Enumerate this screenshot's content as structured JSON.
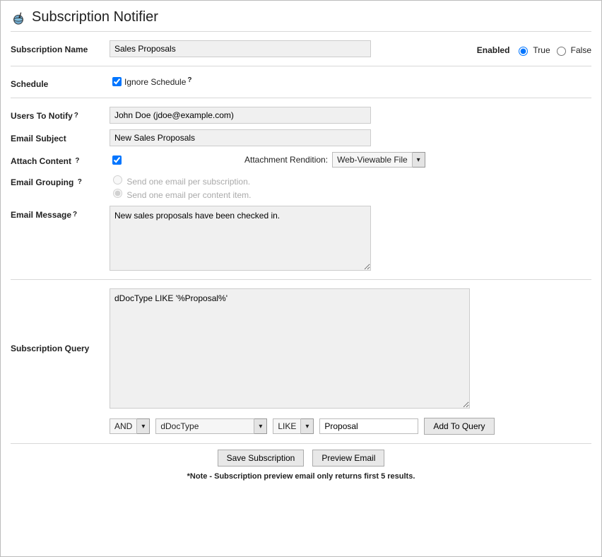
{
  "header": {
    "title": "Subscription Notifier"
  },
  "enabled": {
    "label": "Enabled",
    "true_label": "True",
    "false_label": "False",
    "value": "true"
  },
  "fields": {
    "name_label": "Subscription Name",
    "name_value": "Sales Proposals",
    "schedule_label": "Schedule",
    "ignore_schedule_label": "Ignore Schedule",
    "ignore_schedule_checked": true,
    "users_label": "Users To Notify",
    "users_value": "John Doe (jdoe@example.com)",
    "subject_label": "Email Subject",
    "subject_value": "New Sales Proposals",
    "attach_label": "Attach Content",
    "attach_checked": true,
    "rendition_label": "Attachment Rendition:",
    "rendition_value": "Web-Viewable File",
    "grouping_label": "Email Grouping",
    "grouping_opt1": "Send one email per subscription.",
    "grouping_opt2": "Send one email per content item.",
    "message_label": "Email Message",
    "message_value": "New sales proposals have been checked in.",
    "query_label": "Subscription Query",
    "query_value": "dDocType LIKE '%Proposal%'"
  },
  "query_builder": {
    "conj_value": "AND",
    "field_value": "dDocType",
    "op_value": "LIKE",
    "value_value": "Proposal",
    "add_label": "Add To Query"
  },
  "actions": {
    "save_label": "Save Subscription",
    "preview_label": "Preview Email"
  },
  "note": "*Note - Subscription preview email only returns first 5 results."
}
